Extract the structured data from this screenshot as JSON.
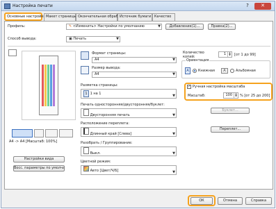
{
  "window": {
    "title": "Настройка печати"
  },
  "tabs": [
    {
      "label": "Основные настройки",
      "active": true
    },
    {
      "label": "Макет страницы"
    },
    {
      "label": "Окончательная обработка"
    },
    {
      "label": "Источник бумаги"
    },
    {
      "label": "Качество"
    }
  ],
  "profile": {
    "label": "Профиль:",
    "value": "<Изменить> Настройки по умолчанию",
    "add_button": "Добавление(1)...",
    "edit_button": "Правка(2)..."
  },
  "output_method": {
    "label": "Способ вывода:",
    "value": "Печать"
  },
  "preview_status": "A4 -> A4 [Масштаб: 100%]",
  "view_settings_button": "Настройки вида",
  "restore_defaults_button": "Восс. параметры по умолчанию",
  "page_size": {
    "label": "Формат страницы:",
    "value": "A4"
  },
  "output_size": {
    "label": "Размер вывода:",
    "value": "A4"
  },
  "copies": {
    "label": "Количество копий:",
    "value": "1",
    "range": "[от 1 до 99]"
  },
  "orientation": {
    "label": "Ориентация",
    "portrait": "Книжная",
    "landscape": "Альбомная",
    "selected": "portrait"
  },
  "page_layout": {
    "label": "Разметка страницы:",
    "value": "1 на 1"
  },
  "manual_scaling": {
    "label": "Ручная настройка масштаба",
    "checked": true
  },
  "scale": {
    "label": "Масштаб:",
    "value": "100",
    "range": "% [от 25 до 200]"
  },
  "duplex": {
    "label": "Печать односторонняя/двусторонняя/буклет:",
    "value": "Двусторонняя печать",
    "booklet_button": "Буклет..."
  },
  "binding": {
    "label": "Расположение переплета:",
    "value": "Длинный край [Слева]",
    "gutter_button": "Переплет..."
  },
  "collate": {
    "label": "Разобрать / Группирование:",
    "value": "Выкл."
  },
  "color_mode": {
    "label": "Цветной режим:",
    "value": "Авто [Цвет/Ч/Б]"
  },
  "footer": {
    "ok": "ОК",
    "cancel": "Отмена",
    "help": "Справка"
  },
  "colors": {
    "accent": "#f5a21d",
    "title_bg": "#c4d7ee"
  }
}
